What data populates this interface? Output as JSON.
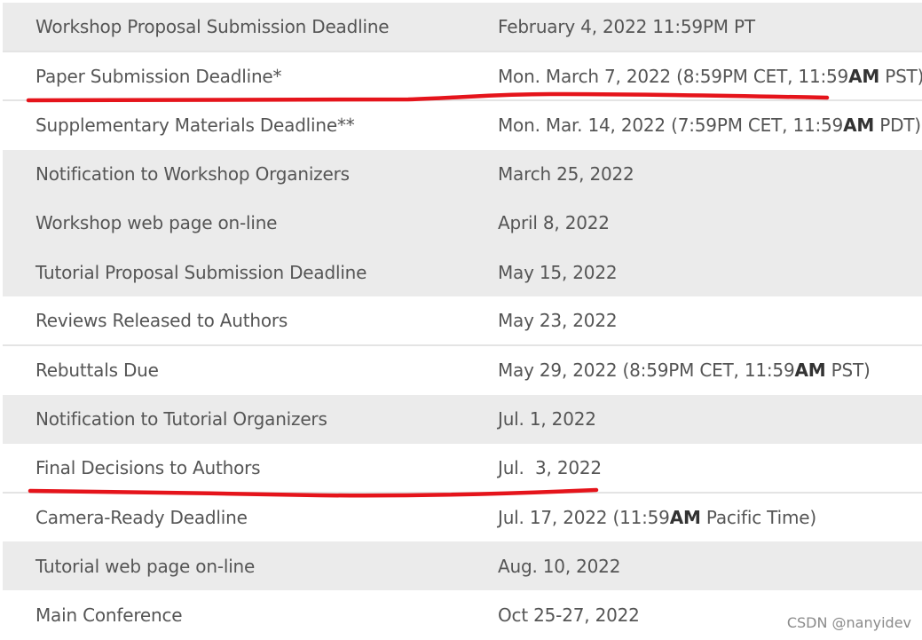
{
  "rows": [
    {
      "event": "Workshop Proposal Submission Deadline",
      "date": [
        {
          "t": "February 4, 2022 11:59PM PT",
          "b": false
        }
      ]
    },
    {
      "event": "Paper Submission Deadline*",
      "date": [
        {
          "t": "Mon. March 7, 2022 (8:59PM CET, 11:59",
          "b": false
        },
        {
          "t": "AM",
          "b": true
        },
        {
          "t": " PST)",
          "b": false
        }
      ]
    },
    {
      "event": "Supplementary Materials Deadline**",
      "date": [
        {
          "t": "Mon. Mar. 14, 2022 (7:59PM CET, 11:59",
          "b": false
        },
        {
          "t": "AM",
          "b": true
        },
        {
          "t": " PDT)",
          "b": false
        }
      ]
    },
    {
      "event": "Notification to Workshop Organizers",
      "date": [
        {
          "t": "March 25, 2022",
          "b": false
        }
      ]
    },
    {
      "event": "Workshop web page on-line",
      "date": [
        {
          "t": "April 8, 2022",
          "b": false
        }
      ]
    },
    {
      "event": "Tutorial Proposal Submission Deadline",
      "date": [
        {
          "t": "May 15, 2022",
          "b": false
        }
      ]
    },
    {
      "event": "Reviews Released to Authors",
      "date": [
        {
          "t": "May 23, 2022",
          "b": false
        }
      ]
    },
    {
      "event": "Rebuttals Due",
      "date": [
        {
          "t": "May 29, 2022 (8:59PM CET, 11:59",
          "b": false
        },
        {
          "t": "AM",
          "b": true
        },
        {
          "t": " PST)",
          "b": false
        }
      ]
    },
    {
      "event": "Notification to Tutorial Organizers",
      "date": [
        {
          "t": "Jul. 1, 2022",
          "b": false
        }
      ]
    },
    {
      "event": "Final Decisions to Authors",
      "date": [
        {
          "t": "Jul.  3, 2022",
          "b": false
        }
      ]
    },
    {
      "event": "Camera-Ready Deadline",
      "date": [
        {
          "t": "Jul. 17, 2022 (11:59",
          "b": false
        },
        {
          "t": "AM",
          "b": true
        },
        {
          "t": " Pacific Time)",
          "b": false
        }
      ]
    },
    {
      "event": "Tutorial web page on-line",
      "date": [
        {
          "t": "Aug. 10, 2022",
          "b": false
        }
      ]
    },
    {
      "event": "Main Conference",
      "date": [
        {
          "t": "Oct 25-27, 2022",
          "b": false
        }
      ]
    }
  ],
  "watermark": "CSDN @nanyidev",
  "colors": {
    "underline": "#e5141b",
    "shaded_row": "#ebebeb",
    "text": "#555555"
  }
}
